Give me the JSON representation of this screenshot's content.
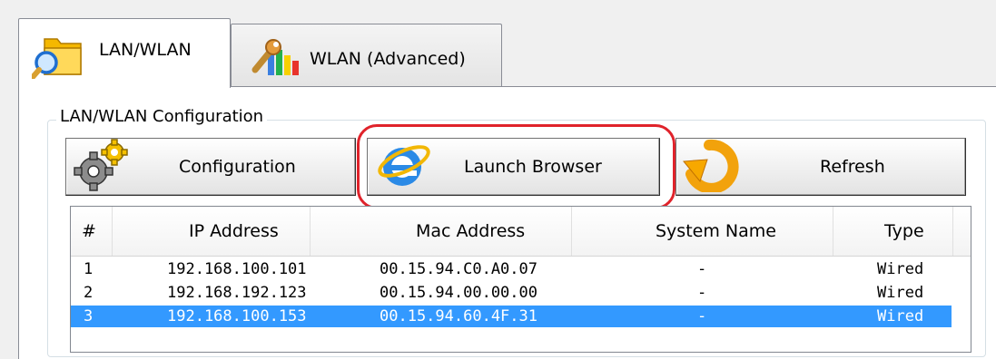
{
  "tabs": [
    {
      "label": "LAN/WLAN",
      "icon": "folder-search-icon",
      "active": true
    },
    {
      "label": "WLAN (Advanced)",
      "icon": "wrench-icon",
      "active": false
    }
  ],
  "group": {
    "title": "LAN/WLAN Configuration"
  },
  "buttons": {
    "configuration": {
      "label": "Configuration",
      "icon": "gear-icon"
    },
    "launch_browser": {
      "label": "Launch Browser",
      "icon": "internet-explorer-icon"
    },
    "refresh": {
      "label": "Refresh",
      "icon": "refresh-arrow-icon"
    }
  },
  "table": {
    "columns": [
      "#",
      "IP Address",
      "Mac Address",
      "System Name",
      "Type"
    ],
    "rows": [
      {
        "num": "1",
        "ip": "192.168.100.101",
        "mac": "00.15.94.C0.A0.07",
        "system_name": "-",
        "type": "Wired",
        "selected": false
      },
      {
        "num": "2",
        "ip": "192.168.192.123",
        "mac": "00.15.94.00.00.00",
        "system_name": "-",
        "type": "Wired",
        "selected": false
      },
      {
        "num": "3",
        "ip": "192.168.100.153",
        "mac": "00.15.94.60.4F.31",
        "system_name": "-",
        "type": "Wired",
        "selected": true
      }
    ]
  },
  "colors": {
    "highlight": "#e0232b",
    "selection": "#3399ff"
  }
}
